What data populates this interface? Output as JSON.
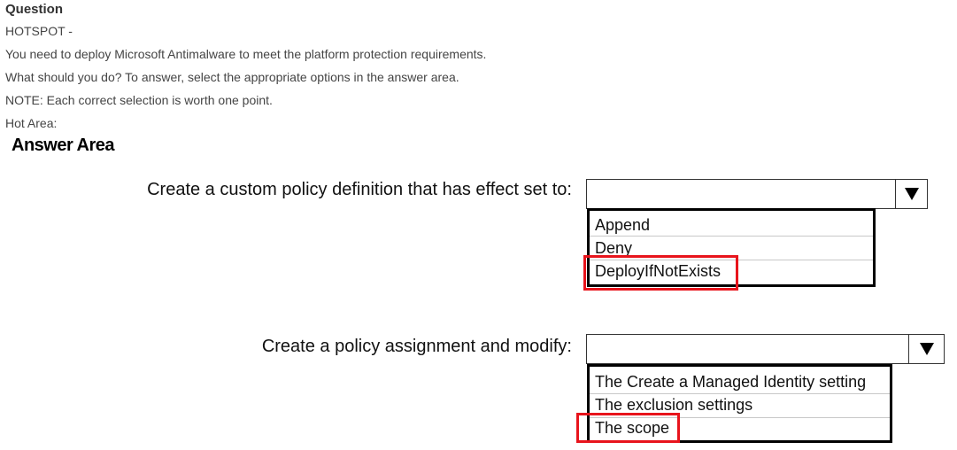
{
  "question": {
    "heading": "Question",
    "lines": [
      "HOTSPOT -",
      "You need to deploy Microsoft Antimalware to meet the platform protection requirements.",
      "What should you do? To answer, select the appropriate options in the answer area.",
      "NOTE: Each correct selection is worth one point.",
      "Hot Area:"
    ]
  },
  "answer_area": {
    "title": "Answer Area",
    "items": [
      {
        "prompt": "Create a custom policy definition that has effect set to:",
        "selected_value": "",
        "options": [
          "Append",
          "Deny",
          "DeployIfNotExists"
        ],
        "highlighted_option": "DeployIfNotExists"
      },
      {
        "prompt": "Create a policy assignment and modify:",
        "selected_value": "",
        "options": [
          "The Create a Managed Identity setting",
          "The exclusion settings",
          "The scope"
        ],
        "highlighted_option": "The scope"
      }
    ]
  },
  "colors": {
    "highlight": "#e8141c",
    "border": "#000000"
  },
  "icons": {
    "dropdown": "triangle-down-icon"
  }
}
